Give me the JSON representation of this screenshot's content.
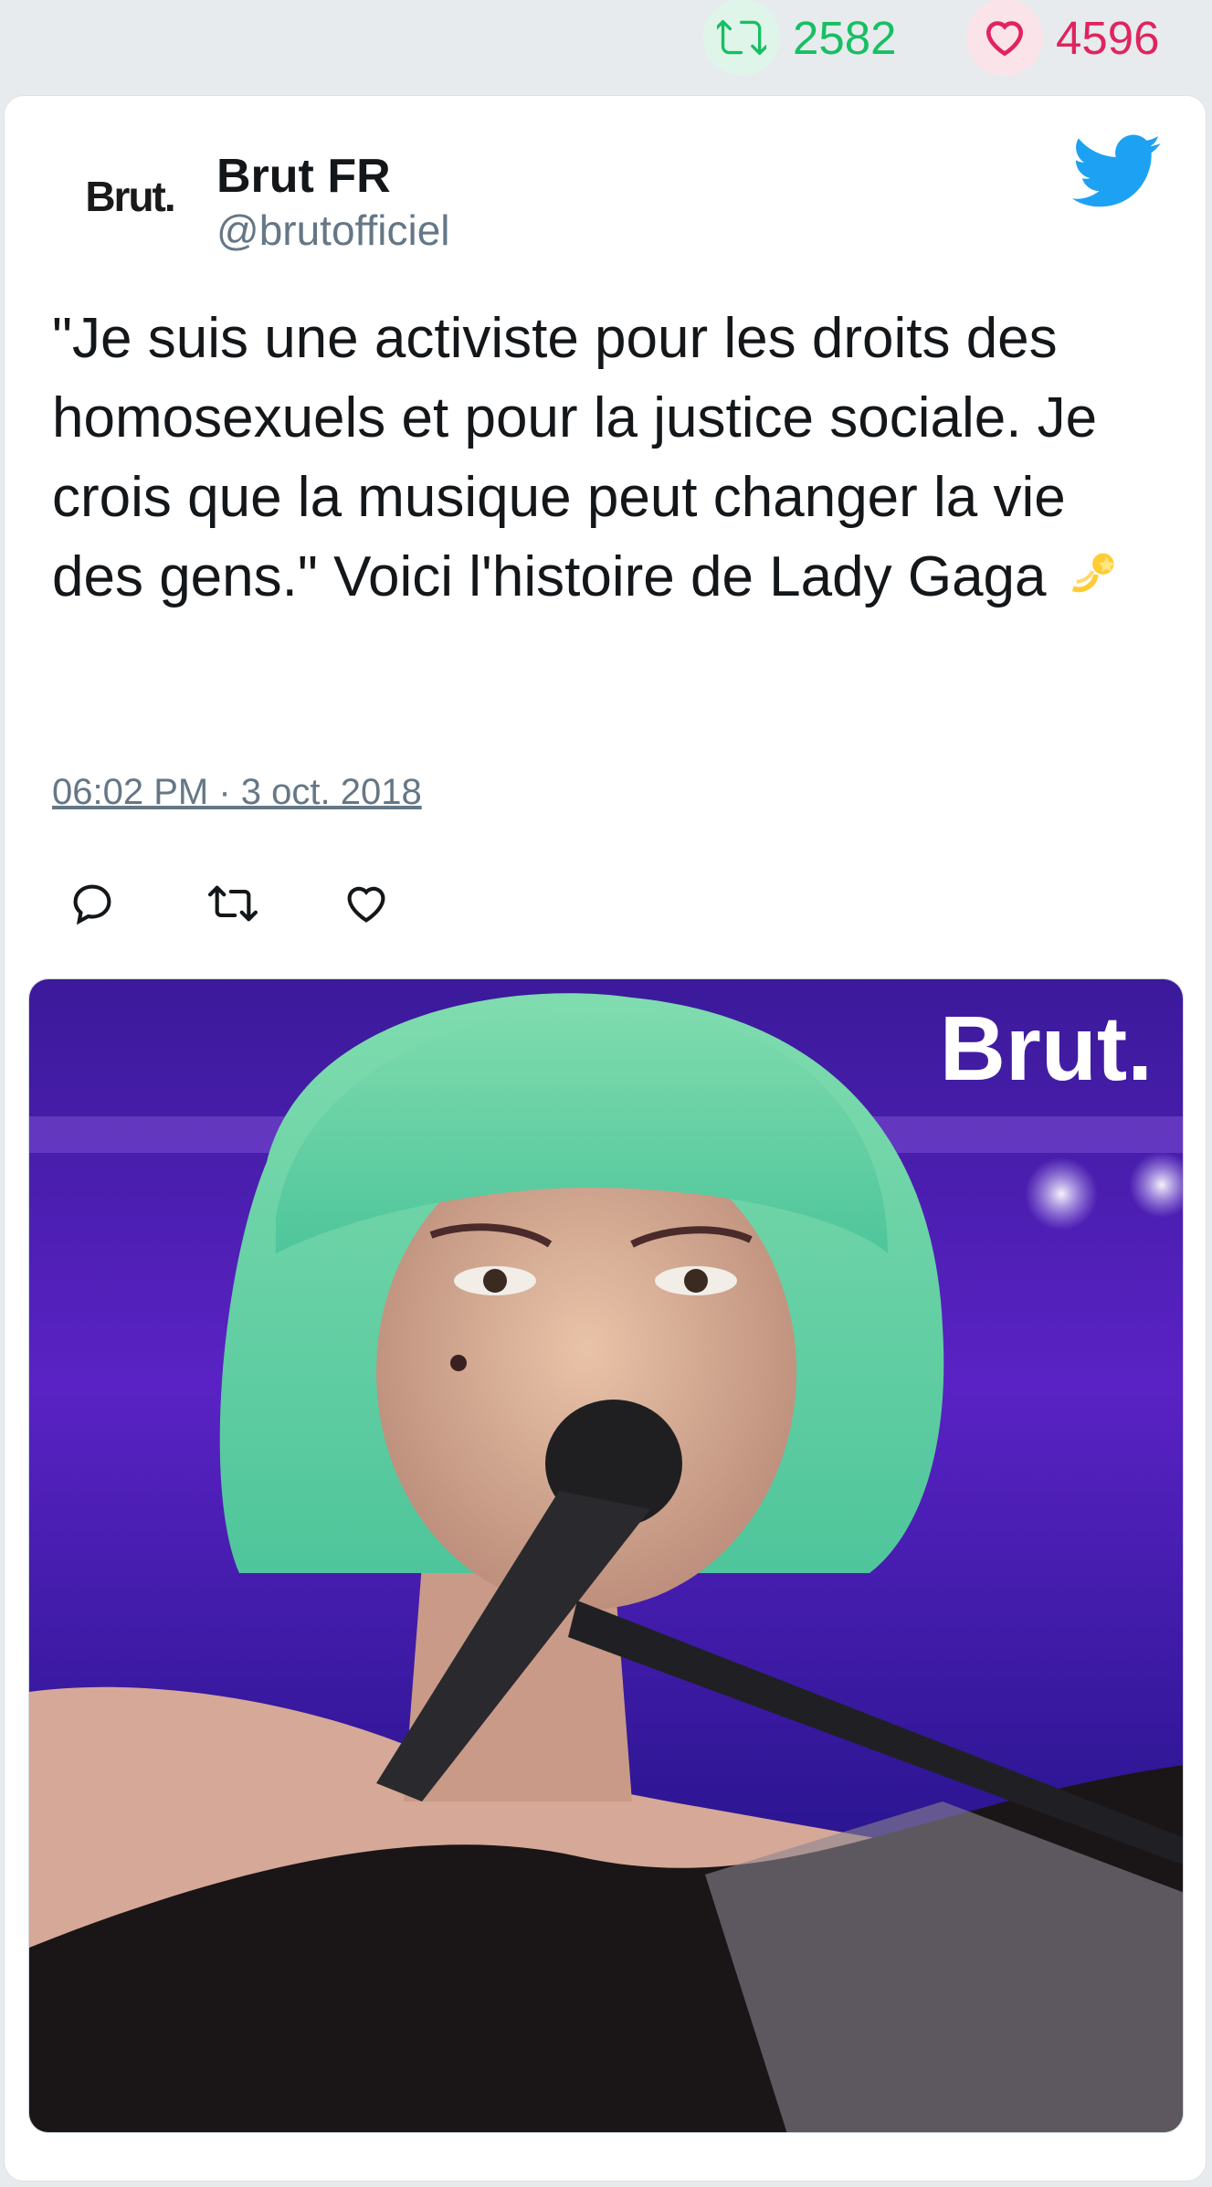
{
  "stats": {
    "retweets": "2582",
    "likes": "4596",
    "retweet_icon": "retweet-icon",
    "like_icon": "heart-icon",
    "retweet_color": "#17bf63",
    "like_color": "#e0245e"
  },
  "tweet": {
    "avatar_text": "Brut.",
    "author_name": "Brut FR",
    "author_handle": "@brutofficiel",
    "platform_icon": "twitter-bird-icon",
    "text": "\"Je suis une activiste pour les droits des homosexuels et pour la justice sociale. Je crois que la musique peut changer la vie des gens.\" Voici l'histoire de Lady Gaga",
    "emoji": "💫",
    "timestamp": "06:02 PM · 3 oct. 2018",
    "actions": [
      "reply-icon",
      "retweet-icon",
      "like-icon"
    ],
    "media": {
      "watermark": "Brut."
    }
  },
  "colors": {
    "twitter_blue": "#1da1f2",
    "text": "#14171a",
    "secondary": "#657786"
  }
}
